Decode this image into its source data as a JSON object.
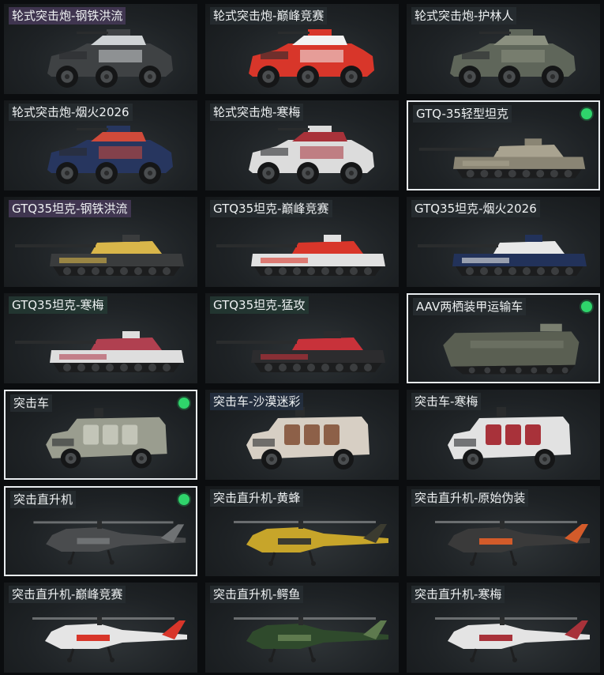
{
  "items": [
    {
      "name": "轮式突击炮-钢铁洪流",
      "type": "wheeled",
      "body": "#3f4244",
      "accent": "#cfd3d5",
      "selected": false,
      "tint": "purple"
    },
    {
      "name": "轮式突击炮-巅峰竞赛",
      "type": "wheeled",
      "body": "#d8362a",
      "accent": "#f2f2f2",
      "selected": false,
      "tint": "none"
    },
    {
      "name": "轮式突击炮-护林人",
      "type": "wheeled",
      "body": "#5f665a",
      "accent": "#8b9080",
      "selected": false,
      "tint": "none"
    },
    {
      "name": "轮式突击炮-烟火2026",
      "type": "wheeled",
      "body": "#27365f",
      "accent": "#d04a3a",
      "selected": false,
      "tint": "none"
    },
    {
      "name": "轮式突击炮-寒梅",
      "type": "wheeled",
      "body": "#dcdcdc",
      "accent": "#a8323a",
      "selected": false,
      "tint": "none"
    },
    {
      "name": "GTQ-35轻型坦克",
      "type": "tank",
      "body": "#8a8574",
      "accent": "#a9a390",
      "selected": true,
      "tint": "none"
    },
    {
      "name": "GTQ35坦克-钢铁洪流",
      "type": "tank",
      "body": "#3a3c3d",
      "accent": "#d9b64a",
      "selected": false,
      "tint": "purple"
    },
    {
      "name": "GTQ35坦克-巅峰竞赛",
      "type": "tank",
      "body": "#e1e1e1",
      "accent": "#d8362a",
      "selected": false,
      "tint": "none"
    },
    {
      "name": "GTQ35坦克-烟火2026",
      "type": "tank",
      "body": "#22325a",
      "accent": "#e8e8e8",
      "selected": false,
      "tint": "none"
    },
    {
      "name": "GTQ35坦克-寒梅",
      "type": "tank",
      "body": "#dedede",
      "accent": "#b04050",
      "selected": false,
      "tint": "green"
    },
    {
      "name": "GTQ35坦克-猛攻",
      "type": "tank",
      "body": "#2c2c2e",
      "accent": "#c8323a",
      "selected": false,
      "tint": "green"
    },
    {
      "name": "AAV两栖装甲运输车",
      "type": "amphibious",
      "body": "#5a5f52",
      "accent": "#7a7f70",
      "selected": true,
      "tint": "none"
    },
    {
      "name": "突击车",
      "type": "assault",
      "body": "#9a9d8f",
      "accent": "#c3c5b8",
      "selected": true,
      "tint": "none"
    },
    {
      "name": "突击车-沙漠迷彩",
      "type": "assault",
      "body": "#d7cfc4",
      "accent": "#8d6048",
      "selected": false,
      "tint": "blue"
    },
    {
      "name": "突击车-寒梅",
      "type": "assault",
      "body": "#e2e2e2",
      "accent": "#a8323a",
      "selected": false,
      "tint": "none"
    },
    {
      "name": "突击直升机",
      "type": "heli",
      "body": "#4a4c4e",
      "accent": "#6f7274",
      "selected": true,
      "tint": "none"
    },
    {
      "name": "突击直升机-黄蜂",
      "type": "heli",
      "body": "#c7a52a",
      "accent": "#3b3b30",
      "selected": false,
      "tint": "none"
    },
    {
      "name": "突击直升机-原始伪装",
      "type": "heli",
      "body": "#3a3a3a",
      "accent": "#d35b2a",
      "selected": false,
      "tint": "none"
    },
    {
      "name": "突击直升机-巅峰竞赛",
      "type": "heli",
      "body": "#e5e5e5",
      "accent": "#d8362a",
      "selected": false,
      "tint": "none"
    },
    {
      "name": "突击直升机-鳄鱼",
      "type": "heli",
      "body": "#2f4a2c",
      "accent": "#5e7a4e",
      "selected": false,
      "tint": "none"
    },
    {
      "name": "突击直升机-寒梅",
      "type": "heli",
      "body": "#e4e4e4",
      "accent": "#a8323a",
      "selected": false,
      "tint": "none"
    }
  ]
}
